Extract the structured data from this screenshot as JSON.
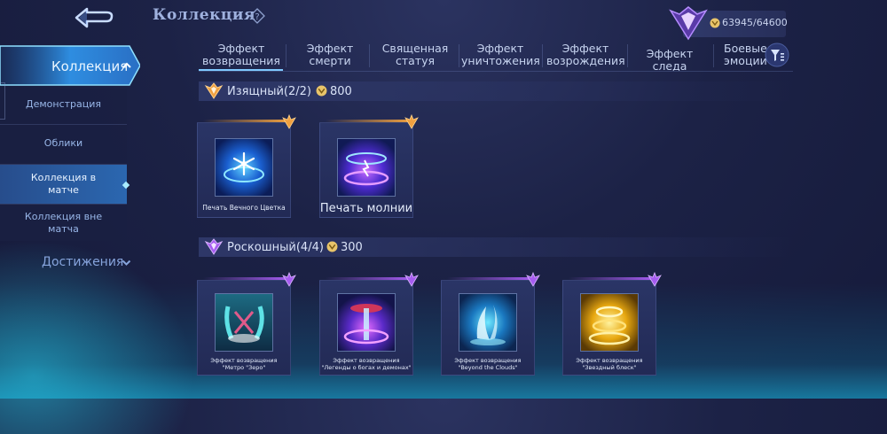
{
  "header": {
    "title": "Коллекция",
    "currency_value": "63945/64600"
  },
  "sidebar": {
    "top_label": "Коллекция",
    "items": [
      {
        "label": "Демонстрация"
      },
      {
        "label": "Облики"
      },
      {
        "label": "Коллекция в матче"
      },
      {
        "label": "Коллекция вне матча"
      }
    ],
    "bottom_label": "Достижения"
  },
  "tabs": [
    {
      "label": "Эффект возвращения"
    },
    {
      "label": "Эффект смерти"
    },
    {
      "label": "Священная статуя"
    },
    {
      "label": "Эффект уничтожения"
    },
    {
      "label": "Эффект возрождения"
    },
    {
      "label": "Эффект следа"
    },
    {
      "label": "Боевые эмоции"
    }
  ],
  "sections": [
    {
      "title": "Изящный(2/2)",
      "price": "800",
      "items": [
        {
          "label": "Печать Вечного Цветка"
        },
        {
          "label": "Печать молнии"
        }
      ]
    },
    {
      "title": "Роскошный(4/4)",
      "price": "300",
      "items": [
        {
          "label_line1": "Эффект возвращения",
          "label_line2": "\"Метро \"Зеро\""
        },
        {
          "label_line1": "Эффект возвращения",
          "label_line2": "\"Легенды о богах и демонах\""
        },
        {
          "label_line1": "Эффект возвращения",
          "label_line2": "\"Beyond the Clouds\""
        },
        {
          "label_line1": "Эффект возвращения",
          "label_line2": "\"Звездный блеск\""
        }
      ]
    }
  ],
  "colors": {
    "accent_cyan": "#7fc9ff",
    "orange_tier": "#f0a040",
    "purple_tier": "#a65cf0"
  }
}
